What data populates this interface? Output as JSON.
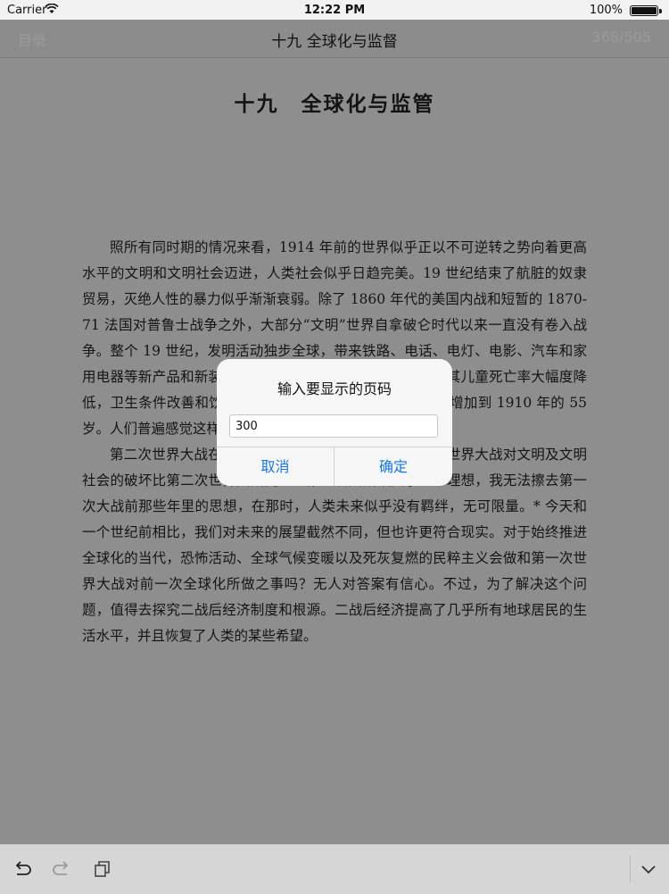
{
  "status": {
    "carrier": "Carrier",
    "time": "12:22 PM",
    "battery": "100%",
    "battery_level": 1.0
  },
  "nav": {
    "back_label": "目录",
    "title": "十九 全球化与监督",
    "page_counter": "368/505"
  },
  "page": {
    "chapter_title": "十九　全球化与监管",
    "paragraphs": [
      "照所有同时期的情况来看，1914 年前的世界似乎正以不可逆转之势向着更高水平的文明和文明社会迈进，人类社会似乎日趋完美。19 世纪结束了航脏的奴隶贸易，灭绝人性的暴力似乎渐渐衰弱。除了 1860 年代的美国内战和短暂的 1870-71 法国对普鲁士战争之外，大部分“文明”世界自拿破仑时代以来一直没有卷入战争。整个 19 世纪，发明活动独步全球，带来铁路、电话、电灯、电影、汽车和家用电器等新产品和新装备。我们称之为发展中世界的国家，其儿童死亡率大幅度降低，卫生条件改善和饮用水广泛推广，从 1820 年的 36 岁增加到 1910 年的 55 岁。人们普遍感觉这样的进步浩浩荡荡，不可阻挡。",
      "第二次世界大战在物质上的破坏要大得多，但是第一次世界大战对文明及文明社会的破坏比第二次世界大战更甚：第一次大战毁灭了一个理想，我无法擦去第一次大战前那些年里的思想，在那时，人类未来似乎没有羁绊，无可限量。* 今天和一个世纪前相比，我们对未来的展望截然不同，但也许更符合现实。对于始终推进全球化的当代，恐怖活动、全球气候变暖以及死灰复燃的民粹主义会做和第一次世界大战对前一次全球化所做之事吗？无人对答案有信心。不过，为了解决这个问题，值得去探究二战后经济制度和根源。二战后经济提高了几乎所有地球居民的生活水平，并且恢复了人类的某些希望。"
    ]
  },
  "dialog": {
    "title": "输入要显示的页码",
    "input_value": "300",
    "cancel_label": "取消",
    "ok_label": "确定"
  },
  "colors": {
    "accent": "#1677e6",
    "overlay": "#8e8e8e",
    "dialog_bg": "#f6f6f6"
  },
  "toolbar": {
    "icons": [
      "undo-icon",
      "redo-icon",
      "copy-icon",
      "chevron-down-icon"
    ]
  }
}
